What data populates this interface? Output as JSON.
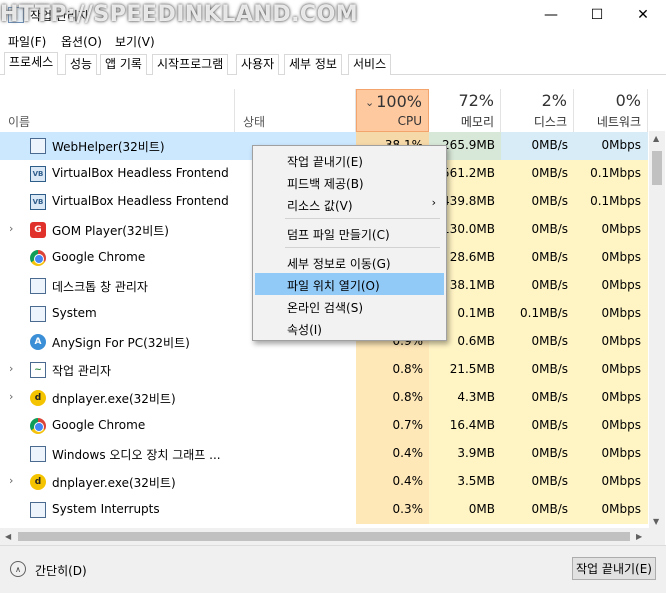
{
  "window": {
    "title": "작업 관리자",
    "watermark": "HTTP://SPEEDINKLAND.COM",
    "controls": {
      "minimize": "—",
      "maximize": "☐",
      "close": "✕"
    }
  },
  "menu": [
    "파일(F)",
    "옵션(O)",
    "보기(V)"
  ],
  "tabs": [
    "프로세스",
    "성능",
    "앱 기록",
    "시작프로그램",
    "사용자",
    "세부 정보",
    "서비스"
  ],
  "active_tab": "프로세스",
  "columns": {
    "name": {
      "label": "이름"
    },
    "status": {
      "label": "상태"
    },
    "cpu": {
      "pct": "100%",
      "label": "CPU",
      "sorted": true
    },
    "memory": {
      "pct": "72%",
      "label": "메모리"
    },
    "disk": {
      "pct": "2%",
      "label": "디스크"
    },
    "network": {
      "pct": "0%",
      "label": "네트워크"
    }
  },
  "processes": [
    {
      "name": "WebHelper(32비트)",
      "icon": "window-icon",
      "expandable": false,
      "cpu": "38.1%",
      "memory": "265.9MB",
      "disk": "0MB/s",
      "network": "0Mbps",
      "selected": true
    },
    {
      "name": "VirtualBox Headless Frontend",
      "icon": "virtualbox-icon",
      "expandable": false,
      "cpu": "",
      "memory": "561.2MB",
      "disk": "0MB/s",
      "network": "0.1Mbps"
    },
    {
      "name": "VirtualBox Headless Frontend",
      "icon": "virtualbox-icon",
      "expandable": false,
      "cpu": "",
      "memory": "439.8MB",
      "disk": "0MB/s",
      "network": "0.1Mbps"
    },
    {
      "name": "GOM Player(32비트)",
      "icon": "gom-player-icon",
      "expandable": true,
      "cpu": "",
      "memory": "130.0MB",
      "disk": "0MB/s",
      "network": "0Mbps"
    },
    {
      "name": "Google Chrome",
      "icon": "chrome-icon",
      "expandable": false,
      "cpu": "",
      "memory": "28.6MB",
      "disk": "0MB/s",
      "network": "0Mbps"
    },
    {
      "name": "데스크톱 창 관리자",
      "icon": "window-icon",
      "expandable": false,
      "cpu": "",
      "memory": "38.1MB",
      "disk": "0MB/s",
      "network": "0Mbps"
    },
    {
      "name": "System",
      "icon": "window-icon",
      "expandable": false,
      "cpu": "",
      "memory": "0.1MB",
      "disk": "0.1MB/s",
      "network": "0Mbps"
    },
    {
      "name": "AnySign For PC(32비트)",
      "icon": "anysign-icon",
      "expandable": false,
      "cpu": "0.9%",
      "memory": "0.6MB",
      "disk": "0MB/s",
      "network": "0Mbps"
    },
    {
      "name": "작업 관리자",
      "icon": "task-manager-icon",
      "expandable": true,
      "cpu": "0.8%",
      "memory": "21.5MB",
      "disk": "0MB/s",
      "network": "0Mbps"
    },
    {
      "name": "dnplayer.exe(32비트)",
      "icon": "dnplayer-icon",
      "expandable": true,
      "cpu": "0.8%",
      "memory": "4.3MB",
      "disk": "0MB/s",
      "network": "0Mbps"
    },
    {
      "name": "Google Chrome",
      "icon": "chrome-icon",
      "expandable": false,
      "cpu": "0.7%",
      "memory": "16.4MB",
      "disk": "0MB/s",
      "network": "0Mbps"
    },
    {
      "name": "Windows 오디오 장치 그래프 ...",
      "icon": "window-icon",
      "expandable": false,
      "cpu": "0.4%",
      "memory": "3.9MB",
      "disk": "0MB/s",
      "network": "0Mbps"
    },
    {
      "name": "dnplayer.exe(32비트)",
      "icon": "dnplayer-icon",
      "expandable": true,
      "cpu": "0.4%",
      "memory": "3.5MB",
      "disk": "0MB/s",
      "network": "0Mbps"
    },
    {
      "name": "System Interrupts",
      "icon": "window-icon",
      "expandable": false,
      "cpu": "0.3%",
      "memory": "0MB",
      "disk": "0MB/s",
      "network": "0Mbps"
    }
  ],
  "context_menu": [
    {
      "label": "작업 끝내기(E)"
    },
    {
      "label": "피드백 제공(B)"
    },
    {
      "label": "리소스 값(V)",
      "submenu": true,
      "arrow": "›"
    },
    {
      "separator": true
    },
    {
      "label": "덤프 파일 만들기(C)"
    },
    {
      "separator": true
    },
    {
      "label": "세부 정보로 이동(G)"
    },
    {
      "label": "파일 위치 열기(O)",
      "highlighted": true
    },
    {
      "label": "온라인 검색(S)"
    },
    {
      "label": "속성(I)"
    }
  ],
  "footer": {
    "fewer_details": "간단히(D)",
    "fewer_icon": "chevron-up-circle-icon",
    "end_task": "작업 끝내기(E)"
  },
  "colors": {
    "selected_row": "#cce8ff",
    "cpu_header": "#ffc9a0",
    "cpu_cell": "#ffe8b8",
    "heat_light": "#fff4c4",
    "menu_highlight": "#91c9f7"
  }
}
